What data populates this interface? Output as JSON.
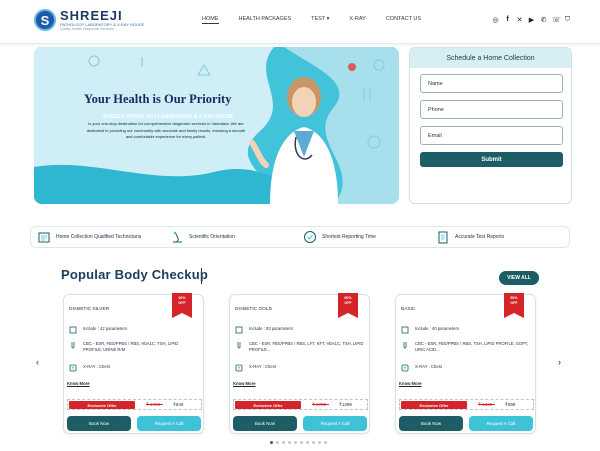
{
  "brand": {
    "name": "SHREEJI",
    "subtitle": "PATHOLOGY LABORATORY & X-RAY HOUSE",
    "tagline": "Quality Health Diagnostic Services"
  },
  "nav": {
    "items": [
      {
        "label": "HOME",
        "active": true
      },
      {
        "label": "HEALTH PACKAGES"
      },
      {
        "label": "TEST ▾"
      },
      {
        "label": "X-RAY"
      },
      {
        "label": "CONTACT US"
      }
    ]
  },
  "social": [
    "instagram-icon",
    "facebook-icon",
    "twitter-icon",
    "youtube-icon",
    "whatsapp-icon",
    "phone-icon",
    "cart-icon"
  ],
  "hero": {
    "title": "Your Health is Our Priority",
    "subtitle": "SHREEJI PATHOLOGY LABORATORY & X-RAY HOUSE",
    "description": "is your one-stop destination for comprehensive diagnostic services in Vadodara. We are dedicated to providing our community with accurate and timely results, ensuring a smooth and comfortable experience for every patient."
  },
  "schedule": {
    "title": "Schedule a Home Collection",
    "name_placeholder": "Name",
    "phone_placeholder": "Phone",
    "email_placeholder": "Email",
    "submit_label": "Submit"
  },
  "features": [
    {
      "label": "Home Collection Qualified Technicians",
      "icon": "home-collection-icon"
    },
    {
      "label": "Scientific Orientation",
      "icon": "microscope-icon"
    },
    {
      "label": "Shortest Reporting Time",
      "icon": "clock-check-icon"
    },
    {
      "label": "Accurate Test Reports",
      "icon": "clipboard-icon"
    }
  ],
  "popular": {
    "title": "Popular Body Checkup",
    "view_all": "VIEW ALL",
    "cards": [
      {
        "name": "DIABETIC SILVER",
        "ribbon_pct": "30%",
        "ribbon_text": "OFF",
        "params": "Include : 42 parameters",
        "tests": "CBC - ESR, FBS/PPBS / RBS, HbA1C, TSH, LIPID PROFILE, URINE R/M",
        "xray": "X-RAY : Chest",
        "know_more": "Know More",
        "offer_label": "Exclusive Offer",
        "old_price": "₹ 1730 -",
        "new_price": "₹849",
        "book": "Book Now",
        "call": "Request A Call"
      },
      {
        "name": "DIABETIC GOLD",
        "ribbon_pct": "50%",
        "ribbon_text": "OFF",
        "params": "Include : 63 parameters",
        "tests": "CBC - ESR, FBS/PPBS / RBS, LFT, KFT, HbA1C, TSH, LIPID PROFILE...",
        "xray": "X-RAY : Chest",
        "know_more": "Know More",
        "offer_label": "Exclusive Offer",
        "old_price": "₹ 2780 -",
        "new_price": "₹1399",
        "book": "Book Now",
        "call": "Request A Call"
      },
      {
        "name": "BASIC",
        "ribbon_pct": "50%",
        "ribbon_text": "OFF",
        "params": "Include : 40 parameters",
        "tests": "CBC - ESR, FBS/PPBS / RBS, TSH, LIPID PROFILE, SGPT, URIC ACID...",
        "xray": "X-RAY : Chest",
        "know_more": "Know More",
        "offer_label": "Exclusive Offer",
        "old_price": "₹ 1830 -",
        "new_price": "₹899",
        "book": "Book Now",
        "call": "Request A Call"
      }
    ]
  },
  "colors": {
    "primary": "#1d5d66",
    "accent": "#3ec2d8",
    "offer": "#d6242b",
    "title": "#1b3d5a"
  }
}
